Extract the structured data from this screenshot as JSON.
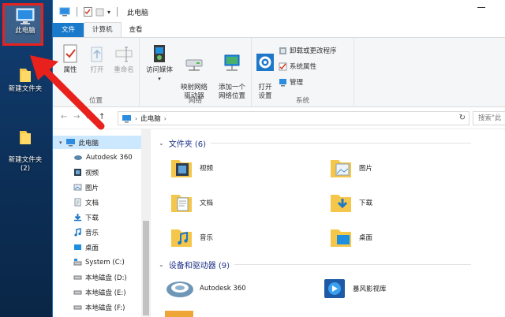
{
  "desktop": {
    "icons": [
      {
        "label": "此电脑"
      },
      {
        "label": "新建文件夹"
      },
      {
        "label": "新建文件夹\n(2)"
      }
    ]
  },
  "titlebar": {
    "title": "此电脑"
  },
  "tabs": [
    "文件",
    "计算机",
    "查看"
  ],
  "ribbon": {
    "location": {
      "name": "位置",
      "buttons": [
        "属性",
        "打开",
        "重命名"
      ]
    },
    "network": {
      "name": "网络",
      "buttons": [
        "访问媒体",
        "映射网络\n驱动器",
        "添加一个\n网络位置"
      ]
    },
    "system": {
      "name": "系统",
      "open_settings": "打开\n设置",
      "items": [
        "卸载或更改程序",
        "系统属性",
        "管理"
      ]
    }
  },
  "address": {
    "path": "此电脑",
    "search_placeholder": "搜索\"此"
  },
  "navpane": {
    "root": "此电脑",
    "items": [
      "Autodesk 360",
      "视频",
      "图片",
      "文档",
      "下载",
      "音乐",
      "桌面",
      "System (C:)",
      "本地磁盘 (D:)",
      "本地磁盘 (E:)",
      "本地磁盘 (F:)"
    ]
  },
  "content": {
    "folders_header": "文件夹 (6)",
    "folders": [
      "视频",
      "图片",
      "文档",
      "下载",
      "音乐",
      "桌面"
    ],
    "devices_header": "设备和驱动器 (9)",
    "devices": [
      "Autodesk 360",
      "暴风影视库"
    ]
  },
  "colors": {
    "accent": "#1979ca",
    "selection": "#cce8ff",
    "annotation_red": "#e8211d",
    "header_blue": "#1e3287"
  }
}
